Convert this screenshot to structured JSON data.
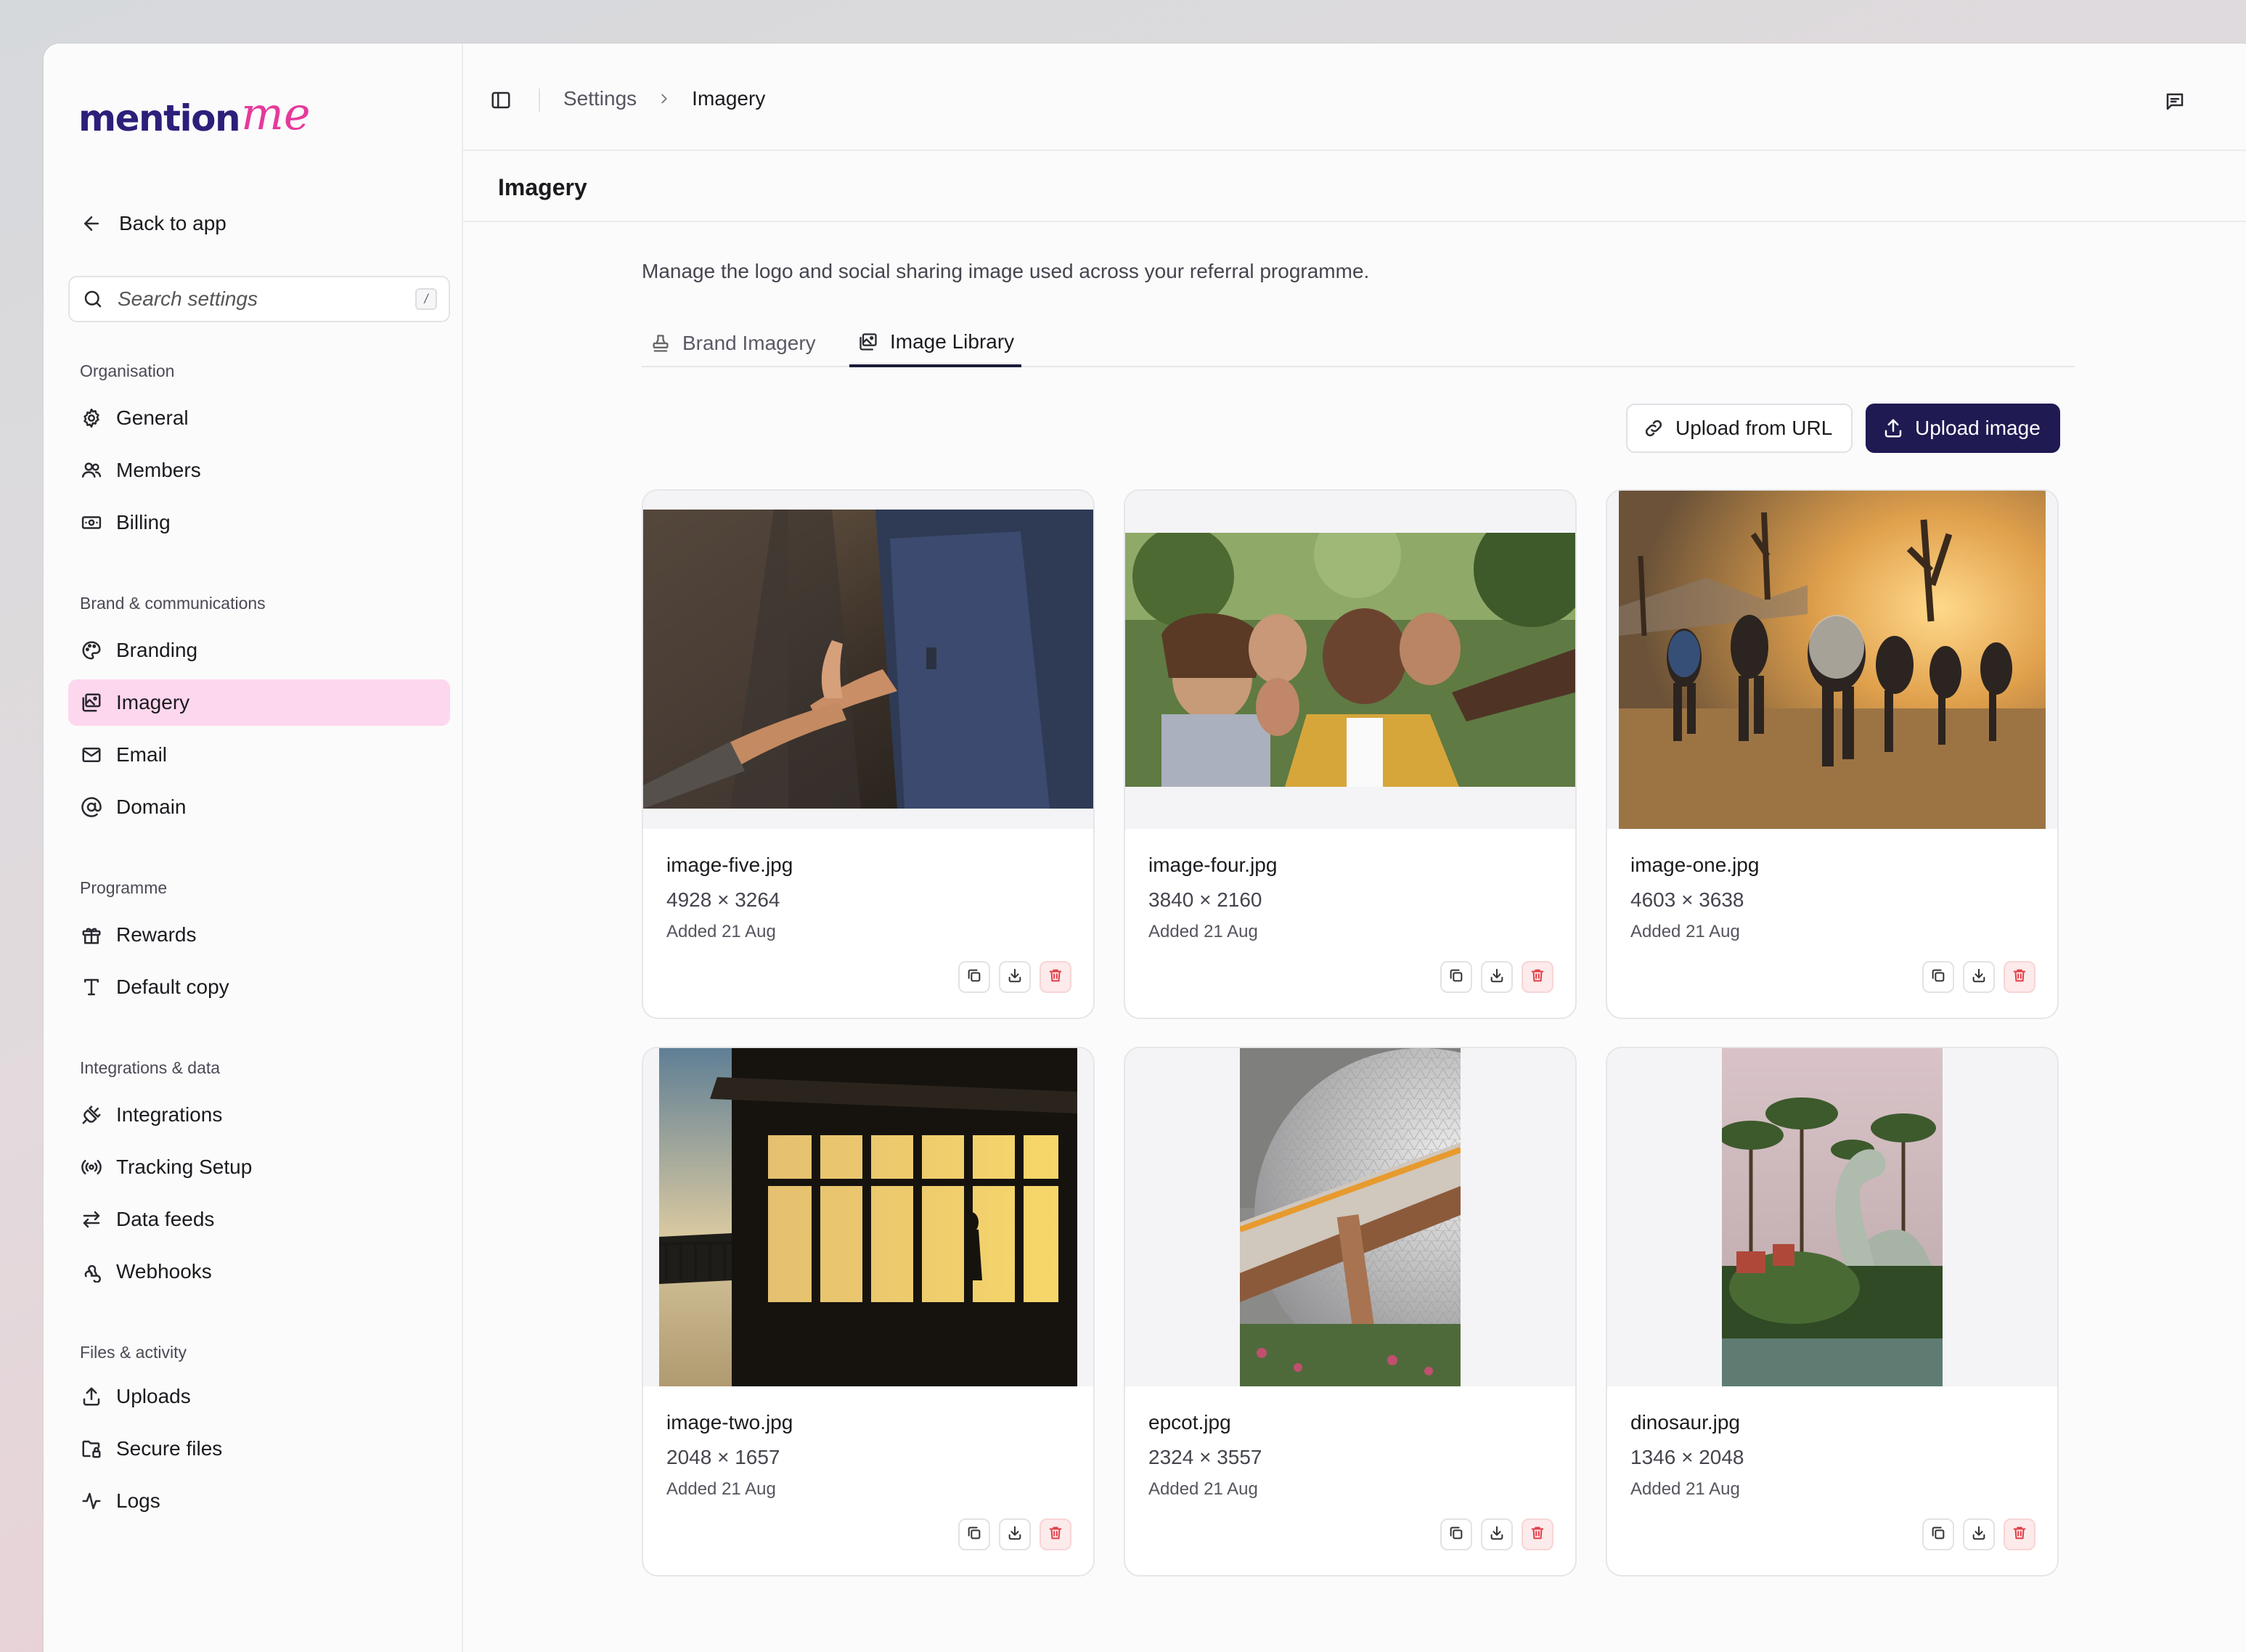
{
  "logo": {
    "part1": "mention",
    "part2": "me"
  },
  "sidebar": {
    "back_label": "Back to app",
    "search_placeholder": "Search settings",
    "search_shortcut": "/",
    "sections": [
      {
        "title": "Organisation",
        "items": [
          {
            "label": "General",
            "icon": "gear-icon"
          },
          {
            "label": "Members",
            "icon": "users-icon"
          },
          {
            "label": "Billing",
            "icon": "banknote-icon"
          }
        ]
      },
      {
        "title": "Brand & communications",
        "items": [
          {
            "label": "Branding",
            "icon": "palette-icon"
          },
          {
            "label": "Imagery",
            "icon": "images-icon",
            "active": true
          },
          {
            "label": "Email",
            "icon": "mail-icon"
          },
          {
            "label": "Domain",
            "icon": "at-sign-icon"
          }
        ]
      },
      {
        "title": "Programme",
        "items": [
          {
            "label": "Rewards",
            "icon": "gift-icon"
          },
          {
            "label": "Default copy",
            "icon": "type-icon"
          }
        ]
      },
      {
        "title": "Integrations & data",
        "items": [
          {
            "label": "Integrations",
            "icon": "plug-icon"
          },
          {
            "label": "Tracking Setup",
            "icon": "radio-icon"
          },
          {
            "label": "Data feeds",
            "icon": "arrows-left-right-icon"
          },
          {
            "label": "Webhooks",
            "icon": "webhook-icon"
          }
        ]
      },
      {
        "title": "Files & activity",
        "items": [
          {
            "label": "Uploads",
            "icon": "upload-icon"
          },
          {
            "label": "Secure files",
            "icon": "folder-lock-icon"
          },
          {
            "label": "Logs",
            "icon": "activity-icon"
          }
        ]
      }
    ]
  },
  "breadcrumb": {
    "parent": "Settings",
    "current": "Imagery"
  },
  "page": {
    "title": "Imagery",
    "description": "Manage the logo and social sharing image used across your referral programme."
  },
  "tabs": [
    {
      "label": "Brand Imagery",
      "icon": "stamp-icon",
      "active": false
    },
    {
      "label": "Image Library",
      "icon": "images-icon",
      "active": true
    }
  ],
  "actions": {
    "upload_url_label": "Upload from URL",
    "upload_image_label": "Upload image"
  },
  "images": [
    {
      "name": "image-five.jpg",
      "dims": "4928 × 3264",
      "added": "Added 21 Aug"
    },
    {
      "name": "image-four.jpg",
      "dims": "3840 × 2160",
      "added": "Added 21 Aug"
    },
    {
      "name": "image-one.jpg",
      "dims": "4603 × 3638",
      "added": "Added 21 Aug"
    },
    {
      "name": "image-two.jpg",
      "dims": "2048 × 1657",
      "added": "Added 21 Aug"
    },
    {
      "name": "epcot.jpg",
      "dims": "2324 × 3557",
      "added": "Added 21 Aug"
    },
    {
      "name": "dinosaur.jpg",
      "dims": "1346 × 2048",
      "added": "Added 21 Aug"
    }
  ],
  "colors": {
    "accent": "#1f1a52",
    "active_nav": "#fdd7ed",
    "logo_primary": "#2b1f7a",
    "logo_accent": "#e6399b",
    "delete": "#e0404a"
  }
}
